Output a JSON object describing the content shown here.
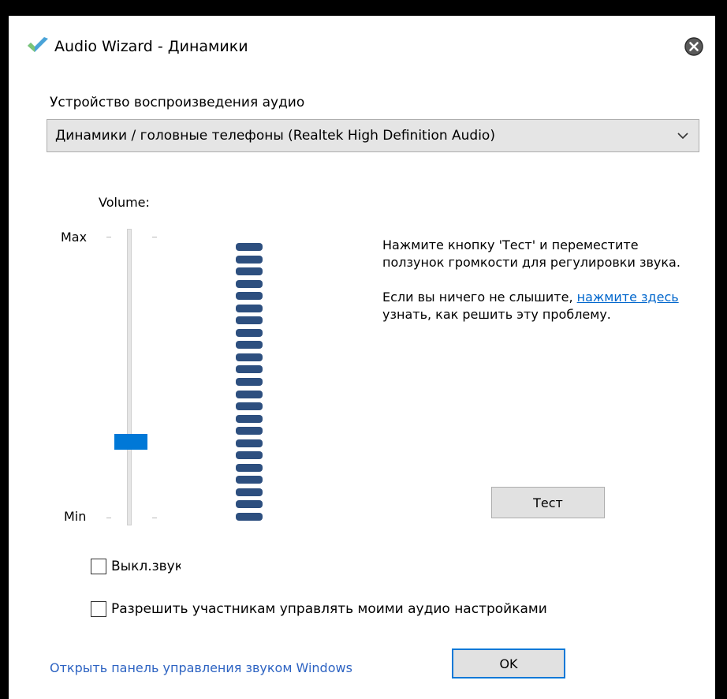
{
  "window": {
    "title": "Audio Wizard - Динамики"
  },
  "device": {
    "label": "Устройство воспроизведения аудио",
    "selected": "Динамики / головные телефоны (Realtek High Definition Audio)"
  },
  "volume": {
    "label": "Volume:",
    "max_label": "Max",
    "min_label": "Min",
    "level_fraction": 0.27,
    "meter_segments": 23
  },
  "instructions": {
    "paragraph1": "Нажмите кнопку 'Тест' и переместите ползунок громкости для регулировки звука.",
    "paragraph2_prefix": "Если вы ничего не слышите, ",
    "link_text": "нажмите здесь",
    "paragraph2_suffix": " узнать, как решить эту проблему."
  },
  "buttons": {
    "test_label": "Тест",
    "ok_label": "OK"
  },
  "checkboxes": {
    "mute_label": "Выкл.звук",
    "mute_checked": false,
    "allow_label": "Разрешить участникам управлять моими аудио настройками",
    "allow_checked": false
  },
  "footer": {
    "sound_panel_link": "Открыть панель управления звуком Windows"
  },
  "colors": {
    "accent": "#0078d7",
    "meter_segment": "#2d4f7f",
    "link": "#0066cc"
  },
  "icons": {
    "app": "zoom-check-icon",
    "close": "close-circle-icon",
    "dropdown": "chevron-down-icon"
  }
}
